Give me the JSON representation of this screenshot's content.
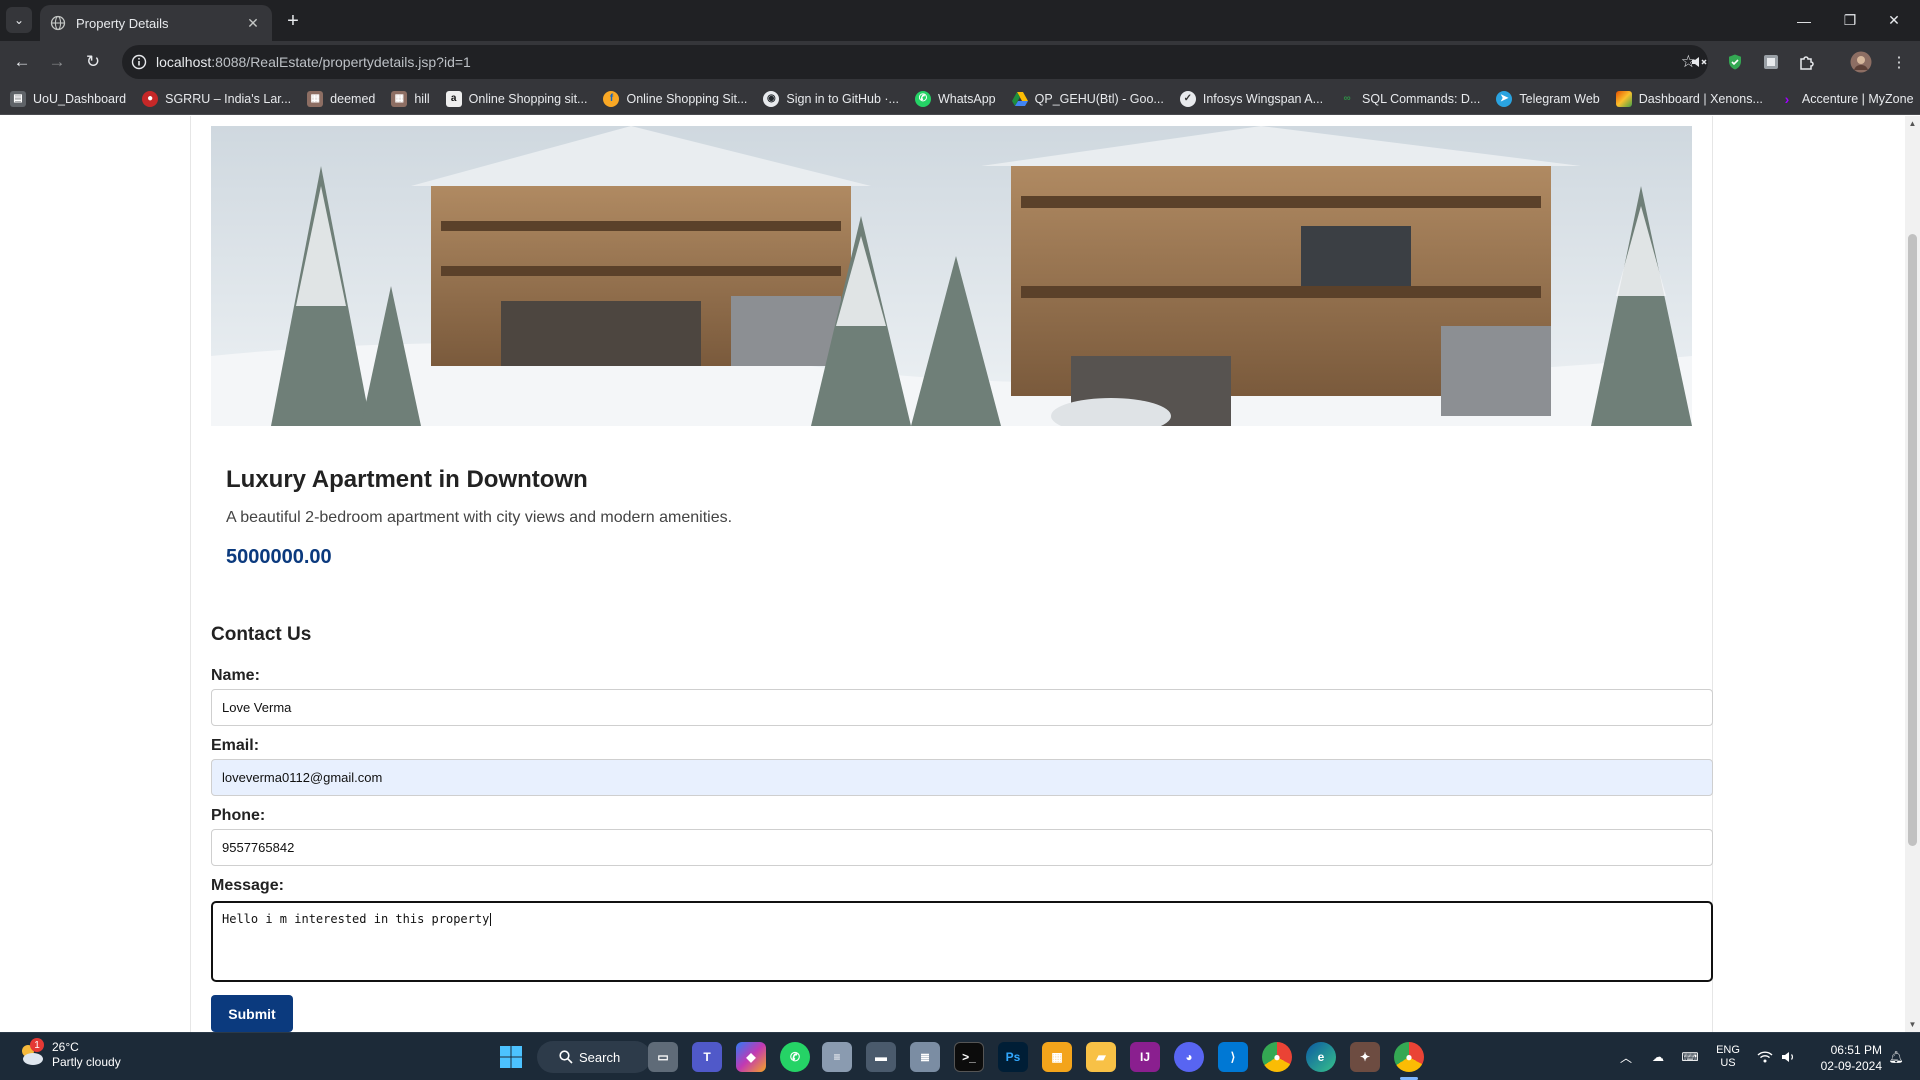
{
  "browser": {
    "tab_title": "Property Details",
    "tab_close": "✕",
    "new_tab": "+",
    "url_host": "localhost",
    "url_path": ":8088/RealEstate/propertydetails.jsp?id=1",
    "window_minimize": "—",
    "window_restore": "❐",
    "window_close": "✕"
  },
  "bookmarks": [
    {
      "label": "UoU_Dashboard",
      "color": "#5f6368",
      "icon": "dashboard-icon"
    },
    {
      "label": "SGRRU – India's Lar...",
      "color": "#c62828",
      "icon": "university-icon"
    },
    {
      "label": "deemed",
      "color": "#8d6e63",
      "icon": "building-icon"
    },
    {
      "label": "hill",
      "color": "#8d6e63",
      "icon": "building-icon"
    },
    {
      "label": "Online Shopping sit...",
      "color": "#111111",
      "icon": "amazon-icon"
    },
    {
      "label": "Online Shopping Sit...",
      "color": "#f9a825",
      "icon": "flipkart-icon"
    },
    {
      "label": "Sign in to GitHub ·...",
      "color": "#24292e",
      "icon": "github-icon"
    },
    {
      "label": "WhatsApp",
      "color": "#25d366",
      "icon": "whatsapp-icon"
    },
    {
      "label": "QP_GEHU(Btl) - Goo...",
      "color": "#1e8e3e",
      "icon": "google-drive-icon"
    },
    {
      "label": "Infosys Wingspan A...",
      "color": "#4a4a4a",
      "icon": "wingspan-icon"
    },
    {
      "label": "SQL Commands: D...",
      "color": "#2f8d46",
      "icon": "geeksforgeeks-icon"
    },
    {
      "label": "Telegram Web",
      "color": "#2aa3e0",
      "icon": "telegram-icon"
    },
    {
      "label": "Dashboard | Xenons...",
      "color": "#e65100",
      "icon": "xenon-icon"
    },
    {
      "label": "Accenture | MyZone",
      "color": "#a100ff",
      "icon": "accenture-icon"
    }
  ],
  "property": {
    "title": "Luxury Apartment in Downtown",
    "description": "A beautiful 2-bedroom apartment with city views and modern amenities.",
    "price": "5000000.00"
  },
  "contact": {
    "heading": "Contact Us",
    "name_label": "Name:",
    "name_value": "Love Verma",
    "email_label": "Email:",
    "email_value": "loveverma0112@gmail.com",
    "phone_label": "Phone:",
    "phone_value": "9557765842",
    "message_label": "Message:",
    "message_value": "Hello i m interested in this property",
    "submit_label": "Submit"
  },
  "taskbar": {
    "weather_temp": "26°C",
    "weather_desc": "Partly cloudy",
    "weather_badge": "1",
    "search_label": "Search",
    "lang_line1": "ENG",
    "lang_line2": "US",
    "time": "06:51 PM",
    "date": "02-09-2024"
  },
  "colors": {
    "accent_button": "#0b3a7e",
    "price": "#0b3a7e",
    "autofill_bg": "#e8f0fe"
  }
}
